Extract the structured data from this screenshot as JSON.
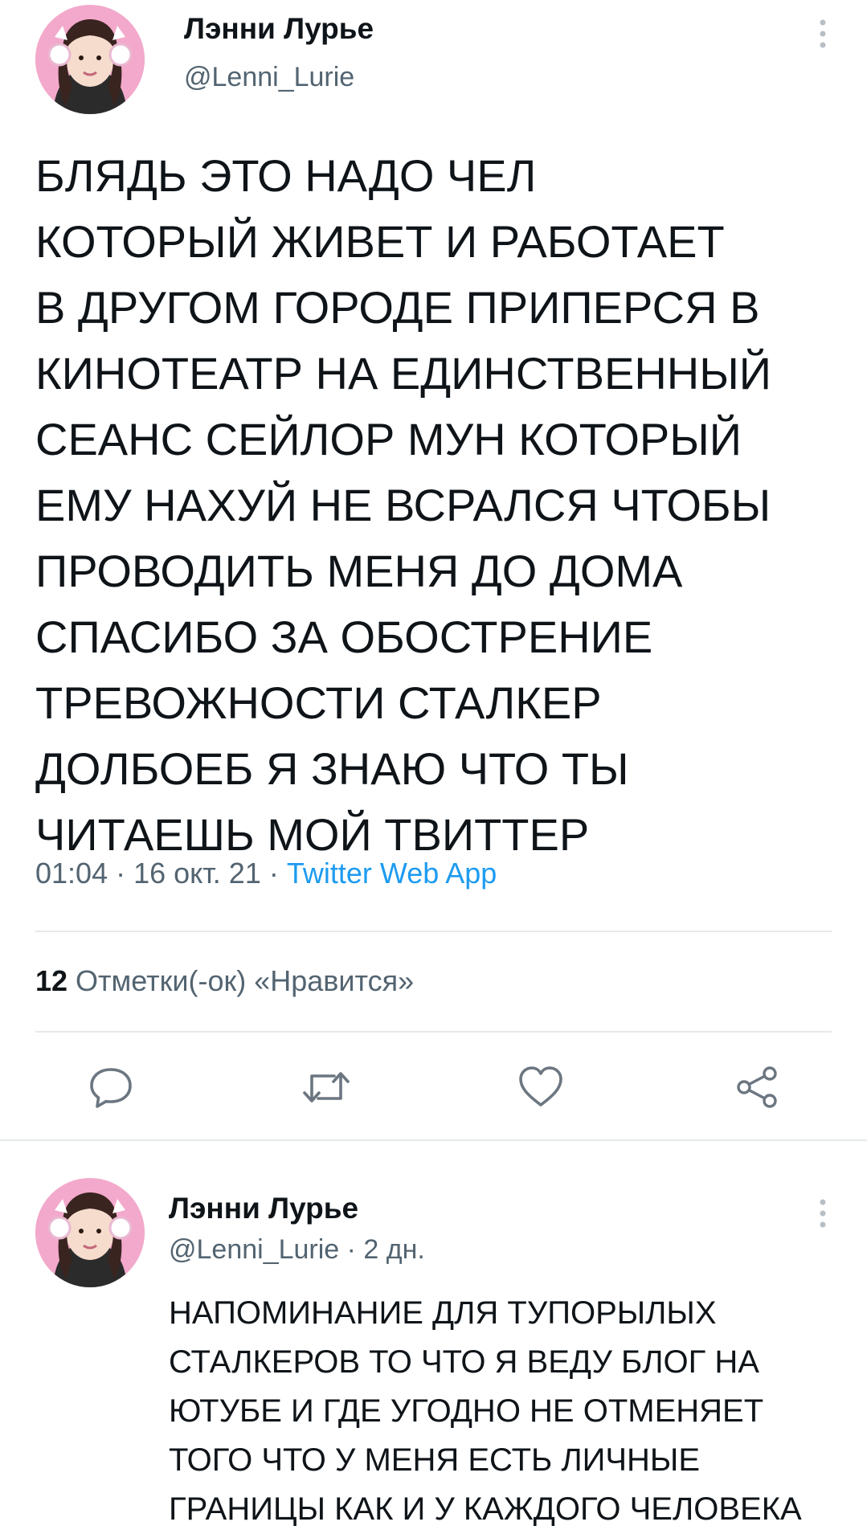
{
  "tweet": {
    "author_name": "Лэнни Лурье",
    "author_handle": "@Lenni_Lurie",
    "text": "БЛЯДЬ ЭТО НАДО ЧЕЛ\nКОТОРЫЙ ЖИВЕТ И РАБОТАЕТ\nВ ДРУГОМ ГОРОДЕ ПРИПЕРСЯ В\nКИНОТЕАТР НА ЕДИНСТВЕННЫЙ\nСЕАНС СЕЙЛОР МУН КОТОРЫЙ\nЕМУ НАХУЙ НЕ ВСРАЛСЯ ЧТОБЫ\nПРОВОДИТЬ МЕНЯ ДО ДОМА\nСПАСИБО ЗА ОБОСТРЕНИЕ\nТРЕВОЖНОСТИ СТАЛКЕР\nДОЛБОЕБ Я ЗНАЮ ЧТО ТЫ\nЧИТАЕШЬ МОЙ ТВИТТЕР",
    "timestamp": "01:04 · 16 окт. 21 · ",
    "source": "Twitter Web App",
    "likes_count": "12",
    "likes_label": " Отметки(-ок) «Нравится»",
    "actions": [
      {
        "name": "reply",
        "icon": "reply-icon"
      },
      {
        "name": "retweet",
        "icon": "retweet-icon"
      },
      {
        "name": "like",
        "icon": "heart-icon"
      },
      {
        "name": "share",
        "icon": "share-icon"
      }
    ]
  },
  "reply_tweet": {
    "author_name": "Лэнни Лурье",
    "author_handle": "@Lenni_Lurie · 2 дн.",
    "text": "НАПОМИНАНИЕ ДЛЯ ТУПОРЫЛЫХ\nСТАЛКЕРОВ ТО ЧТО Я ВЕДУ БЛОГ НА\nЮТУБЕ И ГДЕ УГОДНО НЕ ОТМЕНЯЕТ\nТОГО ЧТО У МЕНЯ ЕСТЬ ЛИЧНЫЕ\nГРАНИЦЫ КАК И У КАЖДОГО ЧЕЛОВЕКА"
  },
  "colors": {
    "text": "#0f1419",
    "secondary": "#536471",
    "link": "#1d9bf0",
    "divider": "#e6e9ec"
  }
}
